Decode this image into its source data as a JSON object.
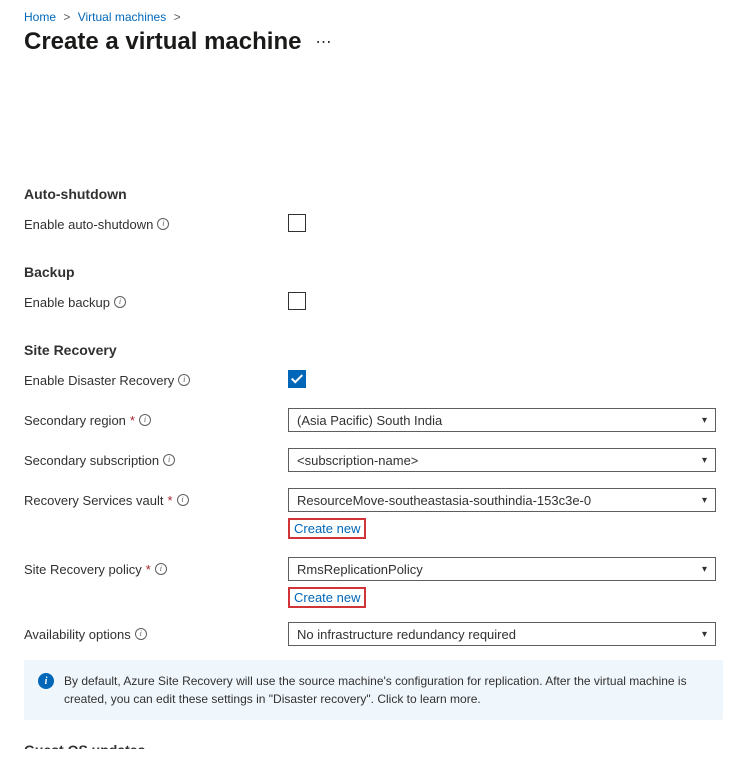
{
  "breadcrumb": {
    "home": "Home",
    "vms": "Virtual machines"
  },
  "page_title": "Create a virtual machine",
  "sections": {
    "auto_shutdown": {
      "title": "Auto-shutdown",
      "enable_label": "Enable auto-shutdown",
      "enable_checked": false
    },
    "backup": {
      "title": "Backup",
      "enable_label": "Enable backup",
      "enable_checked": false
    },
    "site_recovery": {
      "title": "Site Recovery",
      "enable_label": "Enable Disaster Recovery",
      "enable_checked": true,
      "secondary_region": {
        "label": "Secondary region",
        "value": "(Asia Pacific) South India"
      },
      "secondary_subscription": {
        "label": "Secondary subscription",
        "value": "<subscription-name>"
      },
      "vault": {
        "label": "Recovery Services vault",
        "value": "ResourceMove-southeastasia-southindia-153c3e-0",
        "create_new": "Create new"
      },
      "policy": {
        "label": "Site Recovery policy",
        "value": "RmsReplicationPolicy",
        "create_new": "Create new"
      },
      "availability": {
        "label": "Availability options",
        "value": "No infrastructure redundancy required"
      }
    }
  },
  "info_box": "By default, Azure Site Recovery will use the source machine's configuration for replication. After the virtual machine is created, you can edit these settings in \"Disaster recovery\". Click to learn more.",
  "cutoff_section": "Guest OS updates"
}
